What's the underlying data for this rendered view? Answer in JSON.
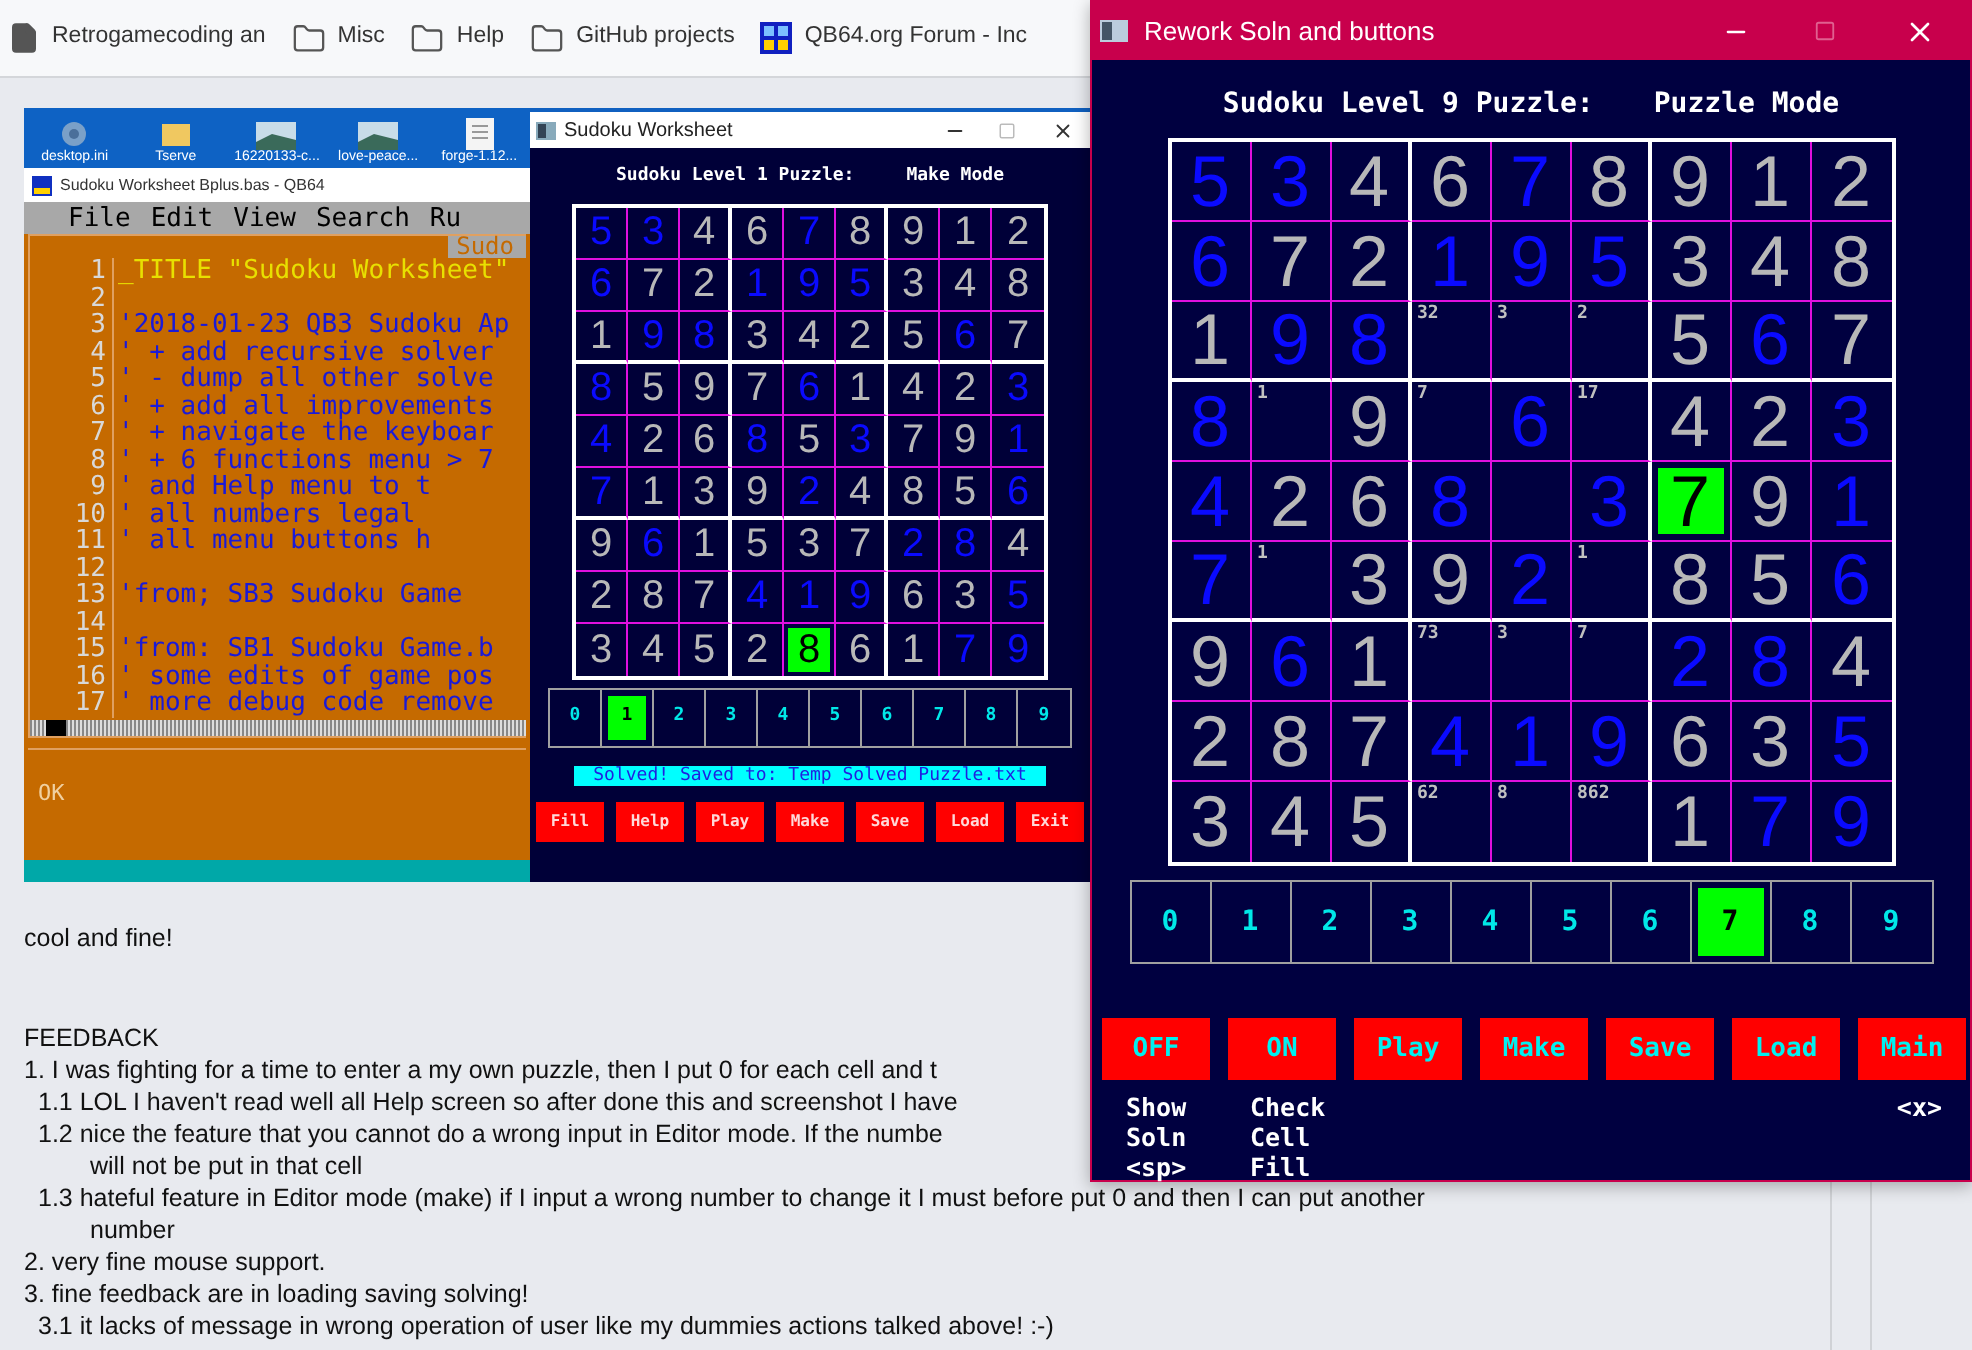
{
  "bookmarks": [
    {
      "kind": "page",
      "label": "Retrogamecoding an"
    },
    {
      "kind": "folder",
      "label": "Misc"
    },
    {
      "kind": "folder",
      "label": "Help"
    },
    {
      "kind": "folder",
      "label": "GitHub projects"
    },
    {
      "kind": "site",
      "label": "QB64.org Forum - Inc"
    }
  ],
  "screenshot": {
    "desktop_icons": [
      {
        "kind": "gear",
        "label": "desktop.ini"
      },
      {
        "kind": "folder",
        "label": "Tserve"
      },
      {
        "kind": "image",
        "label": "16220133-c..."
      },
      {
        "kind": "image",
        "label": "love-peace..."
      },
      {
        "kind": "document",
        "label": "forge-1.12..."
      }
    ],
    "ide": {
      "title": "Sudoku Worksheet Bplus.bas - QB64",
      "menu": [
        "File",
        "Edit",
        "View",
        "Search",
        "Ru"
      ],
      "file_tab": "Sudo",
      "status": "OK",
      "lines": [
        {
          "number": "1",
          "kind": "statement",
          "code": "_TITLE \"Sudoku Worksheet\""
        },
        {
          "number": "2"
        },
        {
          "number": "3",
          "kind": "comment",
          "code": "'2018-01-23 QB3 Sudoku Ap"
        },
        {
          "number": "4",
          "kind": "comment",
          "code": "' + add recursive solver"
        },
        {
          "number": "5",
          "kind": "comment",
          "code": "' - dump all other solve"
        },
        {
          "number": "6",
          "kind": "comment",
          "code": "' + add all improvements"
        },
        {
          "number": "7",
          "kind": "comment",
          "code": "' + navigate the keyboar"
        },
        {
          "number": "8",
          "kind": "comment",
          "code": "' + 6 functions menu > 7"
        },
        {
          "number": "9",
          "kind": "comment",
          "code": "'     and Help menu to t"
        },
        {
          "number": "10",
          "kind": "comment",
          "code": "'     all numbers legal"
        },
        {
          "number": "11",
          "kind": "comment",
          "code": "'     all menu buttons h"
        },
        {
          "number": "12"
        },
        {
          "number": "13",
          "kind": "comment",
          "code": "'from;  SB3 Sudoku Game"
        },
        {
          "number": "14"
        },
        {
          "number": "15",
          "kind": "comment",
          "code": "'from: SB1 Sudoku Game.b"
        },
        {
          "number": "16",
          "kind": "comment",
          "code": "' some edits of game pos"
        },
        {
          "number": "17",
          "kind": "comment",
          "code": "' more debug code remove"
        }
      ]
    },
    "worksheet": {
      "title": "Sudoku Worksheet",
      "heading": "Sudoku Level 1 Puzzle:",
      "mode": "Make Mode",
      "grid": [
        [
          {
            "kind": "given",
            "value": "5"
          },
          {
            "kind": "given",
            "value": "3"
          },
          {
            "kind": "filled",
            "value": "4"
          },
          {
            "kind": "filled",
            "value": "6"
          },
          {
            "kind": "given",
            "value": "7"
          },
          {
            "kind": "filled",
            "value": "8"
          },
          {
            "kind": "filled",
            "value": "9"
          },
          {
            "kind": "filled",
            "value": "1"
          },
          {
            "kind": "filled",
            "value": "2"
          }
        ],
        [
          {
            "kind": "given",
            "value": "6"
          },
          {
            "kind": "filled",
            "value": "7"
          },
          {
            "kind": "filled",
            "value": "2"
          },
          {
            "kind": "given",
            "value": "1"
          },
          {
            "kind": "given",
            "value": "9"
          },
          {
            "kind": "given",
            "value": "5"
          },
          {
            "kind": "filled",
            "value": "3"
          },
          {
            "kind": "filled",
            "value": "4"
          },
          {
            "kind": "filled",
            "value": "8"
          }
        ],
        [
          {
            "kind": "filled",
            "value": "1"
          },
          {
            "kind": "given",
            "value": "9"
          },
          {
            "kind": "given",
            "value": "8"
          },
          {
            "kind": "filled",
            "value": "3"
          },
          {
            "kind": "filled",
            "value": "4"
          },
          {
            "kind": "filled",
            "value": "2"
          },
          {
            "kind": "filled",
            "value": "5"
          },
          {
            "kind": "given",
            "value": "6"
          },
          {
            "kind": "filled",
            "value": "7"
          }
        ],
        [
          {
            "kind": "given",
            "value": "8"
          },
          {
            "kind": "filled",
            "value": "5"
          },
          {
            "kind": "filled",
            "value": "9"
          },
          {
            "kind": "filled",
            "value": "7"
          },
          {
            "kind": "given",
            "value": "6"
          },
          {
            "kind": "filled",
            "value": "1"
          },
          {
            "kind": "filled",
            "value": "4"
          },
          {
            "kind": "filled",
            "value": "2"
          },
          {
            "kind": "given",
            "value": "3"
          }
        ],
        [
          {
            "kind": "given",
            "value": "4"
          },
          {
            "kind": "filled",
            "value": "2"
          },
          {
            "kind": "filled",
            "value": "6"
          },
          {
            "kind": "given",
            "value": "8"
          },
          {
            "kind": "filled",
            "value": "5"
          },
          {
            "kind": "given",
            "value": "3"
          },
          {
            "kind": "filled",
            "value": "7"
          },
          {
            "kind": "filled",
            "value": "9"
          },
          {
            "kind": "given",
            "value": "1"
          }
        ],
        [
          {
            "kind": "given",
            "value": "7"
          },
          {
            "kind": "filled",
            "value": "1"
          },
          {
            "kind": "filled",
            "value": "3"
          },
          {
            "kind": "filled",
            "value": "9"
          },
          {
            "kind": "given",
            "value": "2"
          },
          {
            "kind": "filled",
            "value": "4"
          },
          {
            "kind": "filled",
            "value": "8"
          },
          {
            "kind": "filled",
            "value": "5"
          },
          {
            "kind": "given",
            "value": "6"
          }
        ],
        [
          {
            "kind": "filled",
            "value": "9"
          },
          {
            "kind": "given",
            "value": "6"
          },
          {
            "kind": "filled",
            "value": "1"
          },
          {
            "kind": "filled",
            "value": "5"
          },
          {
            "kind": "filled",
            "value": "3"
          },
          {
            "kind": "filled",
            "value": "7"
          },
          {
            "kind": "given",
            "value": "2"
          },
          {
            "kind": "given",
            "value": "8"
          },
          {
            "kind": "filled",
            "value": "4"
          }
        ],
        [
          {
            "kind": "filled",
            "value": "2"
          },
          {
            "kind": "filled",
            "value": "8"
          },
          {
            "kind": "filled",
            "value": "7"
          },
          {
            "kind": "given",
            "value": "4"
          },
          {
            "kind": "given",
            "value": "1"
          },
          {
            "kind": "given",
            "value": "9"
          },
          {
            "kind": "filled",
            "value": "6"
          },
          {
            "kind": "filled",
            "value": "3"
          },
          {
            "kind": "given",
            "value": "5"
          }
        ],
        [
          {
            "kind": "filled",
            "value": "3"
          },
          {
            "kind": "filled",
            "value": "4"
          },
          {
            "kind": "filled",
            "value": "5"
          },
          {
            "kind": "filled",
            "value": "2"
          },
          {
            "kind": "cursor",
            "value": "8"
          },
          {
            "kind": "filled",
            "value": "6"
          },
          {
            "kind": "filled",
            "value": "1"
          },
          {
            "kind": "given",
            "value": "7"
          },
          {
            "kind": "given",
            "value": "9"
          }
        ]
      ],
      "digits": [
        {
          "label": "0",
          "selected": false
        },
        {
          "label": "1",
          "selected": true
        },
        {
          "label": "2",
          "selected": false
        },
        {
          "label": "3",
          "selected": false
        },
        {
          "label": "4",
          "selected": false
        },
        {
          "label": "5",
          "selected": false
        },
        {
          "label": "6",
          "selected": false
        },
        {
          "label": "7",
          "selected": false
        },
        {
          "label": "8",
          "selected": false
        },
        {
          "label": "9",
          "selected": false
        }
      ],
      "message": "Solved! Saved to: Temp Solved Puzzle.txt",
      "buttons": [
        "Fill",
        "Help",
        "Play",
        "Make",
        "Save",
        "Load",
        "Exit"
      ]
    }
  },
  "post": {
    "lines": [
      "cool and fine!"
    ],
    "heading": "FEEDBACK",
    "items": [
      {
        "text": "1. I was fighting for a time to enter a my own puzzle, then I put 0 for each cell and t",
        "children": [
          {
            "text": "1.1 LOL I haven't read well all Help screen so after done this and screenshot I have"
          },
          {
            "text": "1.2 nice the feature that you cannot do a wrong input in  Editor mode. If the numbe",
            "continuation": "will not be put in that cell"
          },
          {
            "text": "1.3  hateful feature in Editor mode (make) if I input a wrong number to change it I must before put 0 and then I can put another",
            "continuation": "number"
          }
        ]
      },
      {
        "text": "2. very fine mouse support."
      },
      {
        "text": "3. fine feedback are in loading saving solving!",
        "children": [
          {
            "text": "3.1 it lacks of message in wrong operation of user like my dummies actions talked above! :-)"
          }
        ]
      }
    ]
  },
  "window": {
    "title": "Rework Soln and buttons",
    "heading": "Sudoku Level 9 Puzzle:",
    "mode": "Puzzle Mode",
    "grid": [
      [
        {
          "kind": "given",
          "value": "5"
        },
        {
          "kind": "given",
          "value": "3"
        },
        {
          "kind": "filled",
          "value": "4"
        },
        {
          "kind": "filled",
          "value": "6"
        },
        {
          "kind": "given",
          "value": "7"
        },
        {
          "kind": "filled",
          "value": "8"
        },
        {
          "kind": "filled",
          "value": "9"
        },
        {
          "kind": "filled",
          "value": "1"
        },
        {
          "kind": "filled",
          "value": "2"
        }
      ],
      [
        {
          "kind": "given",
          "value": "6"
        },
        {
          "kind": "filled",
          "value": "7"
        },
        {
          "kind": "filled",
          "value": "2"
        },
        {
          "kind": "given",
          "value": "1"
        },
        {
          "kind": "given",
          "value": "9"
        },
        {
          "kind": "given",
          "value": "5"
        },
        {
          "kind": "filled",
          "value": "3"
        },
        {
          "kind": "filled",
          "value": "4"
        },
        {
          "kind": "filled",
          "value": "8"
        }
      ],
      [
        {
          "kind": "filled",
          "value": "1"
        },
        {
          "kind": "given",
          "value": "9"
        },
        {
          "kind": "given",
          "value": "8"
        },
        {
          "kind": "notes",
          "value": "32"
        },
        {
          "kind": "notes",
          "value": "3"
        },
        {
          "kind": "notes",
          "value": "2"
        },
        {
          "kind": "filled",
          "value": "5"
        },
        {
          "kind": "given",
          "value": "6"
        },
        {
          "kind": "filled",
          "value": "7"
        }
      ],
      [
        {
          "kind": "given",
          "value": "8"
        },
        {
          "kind": "notes",
          "value": "1"
        },
        {
          "kind": "filled",
          "value": "9"
        },
        {
          "kind": "notes",
          "value": "7"
        },
        {
          "kind": "given",
          "value": "6"
        },
        {
          "kind": "notes",
          "value": "17"
        },
        {
          "kind": "filled",
          "value": "4"
        },
        {
          "kind": "filled",
          "value": "2"
        },
        {
          "kind": "given",
          "value": "3"
        }
      ],
      [
        {
          "kind": "given",
          "value": "4"
        },
        {
          "kind": "filled",
          "value": "2"
        },
        {
          "kind": "filled",
          "value": "6"
        },
        {
          "kind": "given",
          "value": "8"
        },
        {
          "kind": "empty"
        },
        {
          "kind": "given",
          "value": "3"
        },
        {
          "kind": "cursor",
          "value": "7"
        },
        {
          "kind": "filled",
          "value": "9"
        },
        {
          "kind": "given",
          "value": "1"
        }
      ],
      [
        {
          "kind": "given",
          "value": "7"
        },
        {
          "kind": "notes",
          "value": "1"
        },
        {
          "kind": "filled",
          "value": "3"
        },
        {
          "kind": "filled",
          "value": "9"
        },
        {
          "kind": "given",
          "value": "2"
        },
        {
          "kind": "notes",
          "value": "1"
        },
        {
          "kind": "filled",
          "value": "8"
        },
        {
          "kind": "filled",
          "value": "5"
        },
        {
          "kind": "given",
          "value": "6"
        }
      ],
      [
        {
          "kind": "filled",
          "value": "9"
        },
        {
          "kind": "given",
          "value": "6"
        },
        {
          "kind": "filled",
          "value": "1"
        },
        {
          "kind": "notes",
          "value": "73"
        },
        {
          "kind": "notes",
          "value": "3"
        },
        {
          "kind": "notes",
          "value": "7"
        },
        {
          "kind": "given",
          "value": "2"
        },
        {
          "kind": "given",
          "value": "8"
        },
        {
          "kind": "filled",
          "value": "4"
        }
      ],
      [
        {
          "kind": "filled",
          "value": "2"
        },
        {
          "kind": "filled",
          "value": "8"
        },
        {
          "kind": "filled",
          "value": "7"
        },
        {
          "kind": "given",
          "value": "4"
        },
        {
          "kind": "given",
          "value": "1"
        },
        {
          "kind": "given",
          "value": "9"
        },
        {
          "kind": "filled",
          "value": "6"
        },
        {
          "kind": "filled",
          "value": "3"
        },
        {
          "kind": "given",
          "value": "5"
        }
      ],
      [
        {
          "kind": "filled",
          "value": "3"
        },
        {
          "kind": "filled",
          "value": "4"
        },
        {
          "kind": "filled",
          "value": "5"
        },
        {
          "kind": "notes",
          "value": "62"
        },
        {
          "kind": "notes",
          "value": "8"
        },
        {
          "kind": "notes",
          "value": "862"
        },
        {
          "kind": "filled",
          "value": "1"
        },
        {
          "kind": "given",
          "value": "7"
        },
        {
          "kind": "given",
          "value": "9"
        }
      ]
    ],
    "digits": [
      {
        "label": "0",
        "selected": false
      },
      {
        "label": "1",
        "selected": false
      },
      {
        "label": "2",
        "selected": false
      },
      {
        "label": "3",
        "selected": false
      },
      {
        "label": "4",
        "selected": false
      },
      {
        "label": "5",
        "selected": false
      },
      {
        "label": "6",
        "selected": false
      },
      {
        "label": "7",
        "selected": true
      },
      {
        "label": "8",
        "selected": false
      },
      {
        "label": "9",
        "selected": false
      }
    ],
    "buttons": [
      "OFF",
      "ON",
      "Play",
      "Make",
      "Save",
      "Load",
      "Main"
    ],
    "hints": [
      {
        "lines": [
          "Show",
          "Soln",
          "<sp>"
        ]
      },
      {
        "lines": [
          "Check",
          "Cell",
          "Fill"
        ]
      },
      {
        "lines": [
          "<x>"
        ]
      }
    ]
  }
}
